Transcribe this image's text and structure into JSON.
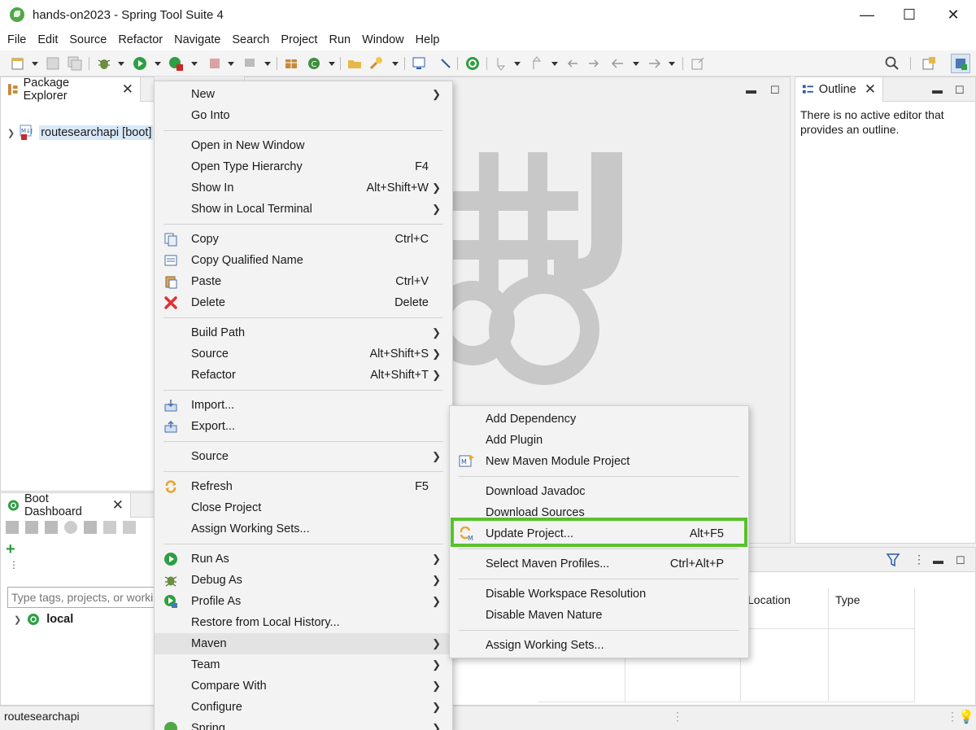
{
  "window": {
    "title": "hands-on2023 - Spring Tool Suite 4",
    "minimize_glyph": "—",
    "maximize_glyph": "☐",
    "close_glyph": "✕"
  },
  "menubar": [
    "File",
    "Edit",
    "Source",
    "Refactor",
    "Navigate",
    "Search",
    "Project",
    "Run",
    "Window",
    "Help"
  ],
  "package_explorer": {
    "tab_label": "Package Explorer",
    "project_label": "routesearchapi [boot]"
  },
  "outline": {
    "tab_label": "Outline",
    "message": "There is no active editor that provides an outline."
  },
  "boot_dashboard": {
    "tab_label": "Boot Dashboard",
    "filter_placeholder": "Type tags, projects, or working set names to match (incl. * and ? wildcards)",
    "local_label": "local"
  },
  "problems_table": {
    "columns": [
      "Location",
      "Type"
    ]
  },
  "status_bar": {
    "selection": "routesearchapi"
  },
  "context_menu": [
    {
      "label": "New",
      "submenu": true
    },
    {
      "label": "Go Into"
    },
    {
      "sep": true
    },
    {
      "label": "Open in New Window"
    },
    {
      "label": "Open Type Hierarchy",
      "accel": "F4"
    },
    {
      "label": "Show In",
      "accel": "Alt+Shift+W",
      "submenu": true
    },
    {
      "label": "Show in Local Terminal",
      "submenu": true
    },
    {
      "sep": true
    },
    {
      "label": "Copy",
      "accel": "Ctrl+C",
      "icon": "copy-icon"
    },
    {
      "label": "Copy Qualified Name",
      "icon": "copy-qualified-name-icon"
    },
    {
      "label": "Paste",
      "accel": "Ctrl+V",
      "icon": "paste-icon"
    },
    {
      "label": "Delete",
      "accel": "Delete",
      "icon": "delete-icon"
    },
    {
      "sep": true
    },
    {
      "label": "Build Path",
      "submenu": true
    },
    {
      "label": "Source",
      "accel": "Alt+Shift+S",
      "submenu": true
    },
    {
      "label": "Refactor",
      "accel": "Alt+Shift+T",
      "submenu": true
    },
    {
      "sep": true
    },
    {
      "label": "Import...",
      "icon": "import-icon"
    },
    {
      "label": "Export...",
      "icon": "export-icon"
    },
    {
      "sep": true
    },
    {
      "label": "Source",
      "submenu": true
    },
    {
      "sep": true
    },
    {
      "label": "Refresh",
      "accel": "F5",
      "icon": "refresh-icon"
    },
    {
      "label": "Close Project"
    },
    {
      "label": "Assign Working Sets..."
    },
    {
      "sep": true
    },
    {
      "label": "Run As",
      "submenu": true,
      "icon": "run-icon"
    },
    {
      "label": "Debug As",
      "submenu": true,
      "icon": "debug-icon"
    },
    {
      "label": "Profile As",
      "submenu": true,
      "icon": "profile-icon"
    },
    {
      "label": "Restore from Local History..."
    },
    {
      "label": "Maven",
      "submenu": true,
      "highlighted": true
    },
    {
      "label": "Team",
      "submenu": true
    },
    {
      "label": "Compare With",
      "submenu": true
    },
    {
      "label": "Configure",
      "submenu": true
    },
    {
      "label": "Spring",
      "submenu": true,
      "icon": "spring-icon"
    }
  ],
  "maven_submenu": [
    {
      "label": "Add Dependency"
    },
    {
      "label": "Add Plugin"
    },
    {
      "label": "New Maven Module Project",
      "icon": "maven-module-icon"
    },
    {
      "sep": true
    },
    {
      "label": "Download Javadoc"
    },
    {
      "label": "Download Sources"
    },
    {
      "label": "Update Project...",
      "accel": "Alt+F5",
      "icon": "update-project-icon",
      "emphasized": true
    },
    {
      "sep": true
    },
    {
      "label": "Select Maven Profiles...",
      "accel": "Ctrl+Alt+P"
    },
    {
      "sep": true
    },
    {
      "label": "Disable Workspace Resolution"
    },
    {
      "label": "Disable Maven Nature"
    },
    {
      "sep": true
    },
    {
      "label": "Assign Working Sets..."
    }
  ],
  "colors": {
    "highlight_box": "#57c22a",
    "spring_green": "#4fa845",
    "menu_bg": "#f3f3f3"
  }
}
